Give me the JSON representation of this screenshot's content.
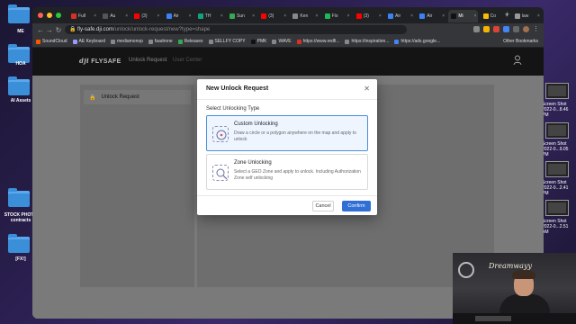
{
  "desktop": {
    "left_icons": [
      {
        "label": "ME"
      },
      {
        "label": "HOA"
      },
      {
        "label": "AI Assets"
      },
      {
        "label": "STOCK PHOTO contracts"
      },
      {
        "label": "[FX!]"
      }
    ],
    "right_icons": [
      {
        "label": "Screen Shot 2022-0...8.46 PM"
      },
      {
        "label": "Screen Shot 2022-0...9.05 PM"
      },
      {
        "label": "Screen Shot 2022-0...2.41 PM"
      },
      {
        "label": "Screen Shot 2022-0...2.51 AM"
      }
    ]
  },
  "browser": {
    "tabs": [
      {
        "label": "Full",
        "color": "#d93025"
      },
      {
        "label": "Au",
        "color": "#555555"
      },
      {
        "label": "(3)",
        "color": "#ff0000"
      },
      {
        "label": "Air",
        "color": "#3b82f6"
      },
      {
        "label": "TH",
        "color": "#10a37f"
      },
      {
        "label": "Sun",
        "color": "#34a853"
      },
      {
        "label": "(3)",
        "color": "#ff0000"
      },
      {
        "label": "Ken",
        "color": "#888888"
      },
      {
        "label": "Flo",
        "color": "#1db954"
      },
      {
        "label": "(3)",
        "color": "#ff0000"
      },
      {
        "label": "Air",
        "color": "#3b82f6"
      },
      {
        "label": "Air",
        "color": "#3b82f6"
      },
      {
        "label": "Mi",
        "color": "#111111",
        "active": true
      },
      {
        "label": "Co",
        "color": "#fbbc05"
      },
      {
        "label": "law",
        "color": "#999999"
      }
    ],
    "url_host": "fly-safe.dji.com",
    "url_path": "/unlock/unlock-request/new?type=shape",
    "bookmarks": [
      {
        "label": "SoundCloud",
        "color": "#ff5500"
      },
      {
        "label": "AE Keyboard",
        "color": "#9999ff"
      },
      {
        "label": "mediamonop",
        "color": "#888888"
      },
      {
        "label": "faadrone",
        "color": "#888888"
      },
      {
        "label": "Releases",
        "color": "#34a853"
      },
      {
        "label": "SELLFY COPY",
        "color": "#888888"
      },
      {
        "label": "PMK",
        "color": "#111111"
      },
      {
        "label": "WAVE",
        "color": "#888888"
      },
      {
        "label": "https://www.redfi...",
        "color": "#d93025"
      },
      {
        "label": "https://inspiration...",
        "color": "#888888"
      },
      {
        "label": "https://ads.google...",
        "color": "#4285f4"
      }
    ],
    "other_bookmarks": "Other Bookmarks"
  },
  "site": {
    "logo": "FLYSAFE",
    "nav": [
      "Unlock Request",
      "User Center"
    ],
    "sidebar_item": "Unlock Request"
  },
  "modal": {
    "title": "New Unlock Request",
    "subtitle": "Select Unlocking Type",
    "options": [
      {
        "title": "Custom Unlocking",
        "description": "Draw a circle or a polygon anywhere on the map and apply to unlock",
        "selected": true
      },
      {
        "title": "Zone Unlocking",
        "description": "Select a GEO Zone and apply to unlock. Including Authorization Zone self unlocking",
        "selected": false
      }
    ],
    "cancel": "Cancel",
    "confirm": "Confirm"
  },
  "colors": {
    "accent": "#2f6fd6",
    "selected_border": "#4a90d9",
    "header_bg": "#141414"
  }
}
